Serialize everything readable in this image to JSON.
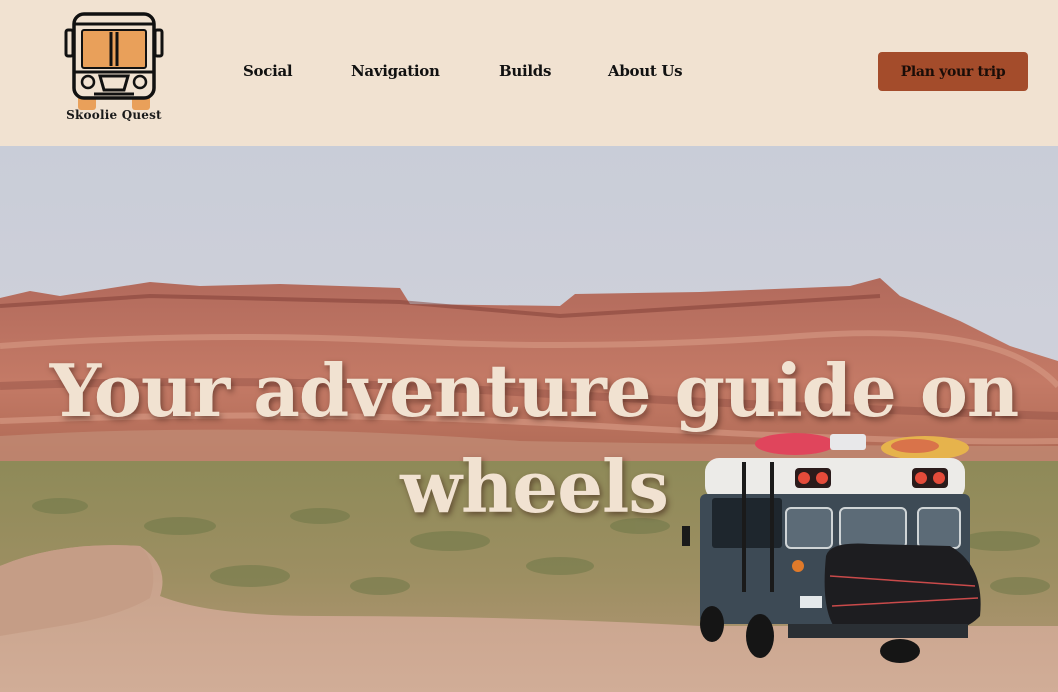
{
  "brand": {
    "name": "Skoolie Quest",
    "logo_icon": "school-bus-icon"
  },
  "nav": {
    "items": [
      {
        "label": "Social"
      },
      {
        "label": "Navigation"
      },
      {
        "label": "Builds"
      },
      {
        "label": "About Us"
      }
    ]
  },
  "header": {
    "cta_label": "Plan your trip"
  },
  "hero": {
    "title": "Your adventure guide on wheels",
    "image": "desert-mesa-with-school-bus-photo"
  },
  "colors": {
    "header_bg": "#f1e2d1",
    "accent": "#a44c2b",
    "logo_orange": "#e9a05a",
    "hero_text": "#f1e2d1"
  }
}
